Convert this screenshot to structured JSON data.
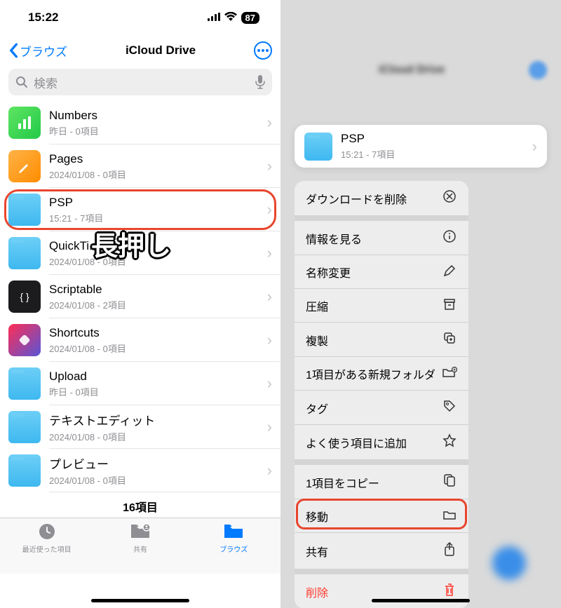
{
  "status": {
    "time": "15:22",
    "battery": "87"
  },
  "nav": {
    "back": "ブラウズ",
    "title": "iCloud Drive"
  },
  "search": {
    "placeholder": "検索"
  },
  "files": [
    {
      "name": "Numbers",
      "meta": "昨日 - 0項目",
      "icon": "numbers"
    },
    {
      "name": "Pages",
      "meta": "2024/01/08 - 0項目",
      "icon": "pages"
    },
    {
      "name": "PSP",
      "meta": "15:21 - 7項目",
      "icon": "folder",
      "highlighted": true
    },
    {
      "name": "QuickTi...",
      "meta": "2024/01/08 - 0項目",
      "icon": "folder"
    },
    {
      "name": "Scriptable",
      "meta": "2024/01/08 - 2項目",
      "icon": "scriptable"
    },
    {
      "name": "Shortcuts",
      "meta": "2024/01/08 - 0項目",
      "icon": "shortcuts"
    },
    {
      "name": "Upload",
      "meta": "昨日 - 0項目",
      "icon": "folder"
    },
    {
      "name": "テキストエディット",
      "meta": "2024/01/08 - 0項目",
      "icon": "folder"
    },
    {
      "name": "プレビュー",
      "meta": "2024/01/08 - 0項目",
      "icon": "folder"
    }
  ],
  "footer": {
    "count": "16項目"
  },
  "tabs": {
    "recent": "最近使った項目",
    "shared": "共有",
    "browse": "ブラウズ"
  },
  "annotation": {
    "longpress": "長押し"
  },
  "popover": {
    "name": "PSP",
    "meta": "15:21 - 7項目"
  },
  "menu": {
    "removeDownload": "ダウンロードを削除",
    "getInfo": "情報を見る",
    "rename": "名称変更",
    "compress": "圧縮",
    "duplicate": "複製",
    "newFolder": "1項目がある新規フォルダ",
    "tags": "タグ",
    "favorite": "よく使う項目に追加",
    "copy": "1項目をコピー",
    "move": "移動",
    "share": "共有",
    "delete": "削除"
  }
}
